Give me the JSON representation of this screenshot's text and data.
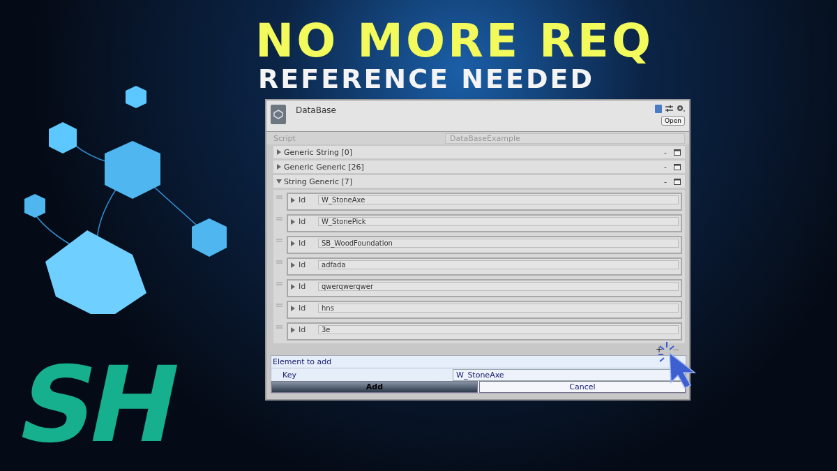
{
  "headline": {
    "title": "NO MORE REQ",
    "subtitle": "REFERENCE NEEDED"
  },
  "logo": {
    "text": "SH"
  },
  "inspector": {
    "title": "DataBase",
    "open_button": "Open",
    "script": {
      "label": "Script",
      "value": "DataBaseExample"
    },
    "lists": [
      {
        "label": "Generic String [0]",
        "expanded": false,
        "remove": "-"
      },
      {
        "label": "Generic Generic [26]",
        "expanded": false,
        "remove": "-"
      },
      {
        "label": "String Generic [7]",
        "expanded": true,
        "remove": "-",
        "items": [
          {
            "label": "Id",
            "value": "W_StoneAxe"
          },
          {
            "label": "Id",
            "value": "W_StonePick"
          },
          {
            "label": "Id",
            "value": "SB_WoodFoundation"
          },
          {
            "label": "Id",
            "value": "adfada"
          },
          {
            "label": "Id",
            "value": "qwerqwerqwer"
          },
          {
            "label": "Id",
            "value": "hns"
          },
          {
            "label": "Id",
            "value": "3e"
          }
        ]
      }
    ],
    "add": "+",
    "remove": "−",
    "popup": {
      "title": "Element to add",
      "key_label": "Key",
      "key_value": "W_StoneAxe",
      "buttons": [
        {
          "label": "Add",
          "selected": true
        },
        {
          "label": "Cancel",
          "selected": false
        }
      ]
    }
  }
}
